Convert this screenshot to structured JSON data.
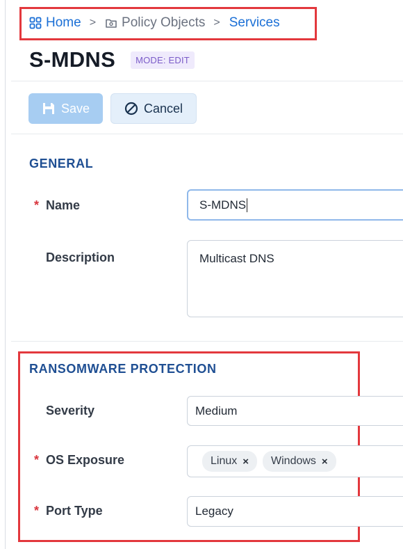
{
  "breadcrumb": {
    "home": "Home",
    "policy_objects": "Policy Objects",
    "services": "Services",
    "separator": ">"
  },
  "page": {
    "title": "S-MDNS",
    "mode_badge": "MODE: EDIT"
  },
  "toolbar": {
    "save_label": "Save",
    "cancel_label": "Cancel"
  },
  "general": {
    "heading": "GENERAL",
    "name_label": "Name",
    "name_value": "S-MDNS",
    "description_label": "Description",
    "description_value": "Multicast DNS",
    "required_mark": "*"
  },
  "ransomware": {
    "heading": "RANSOMWARE PROTECTION",
    "severity_label": "Severity",
    "severity_value": "Medium",
    "os_exposure_label": "OS Exposure",
    "os_exposure_tags": [
      "Linux",
      "Windows"
    ],
    "port_type_label": "Port Type",
    "port_type_value": "Legacy",
    "tag_remove": "×"
  },
  "colors": {
    "accent": "#1a6fd6",
    "highlight_border": "#e3383d",
    "section_heading": "#1f4f93",
    "required": "#d9363e",
    "save_disabled": "#a7cdf2"
  },
  "icons": {
    "home": "grid-icon",
    "policy_objects": "folder-icon",
    "save": "floppy-disk-icon",
    "cancel": "prohibited-icon"
  }
}
